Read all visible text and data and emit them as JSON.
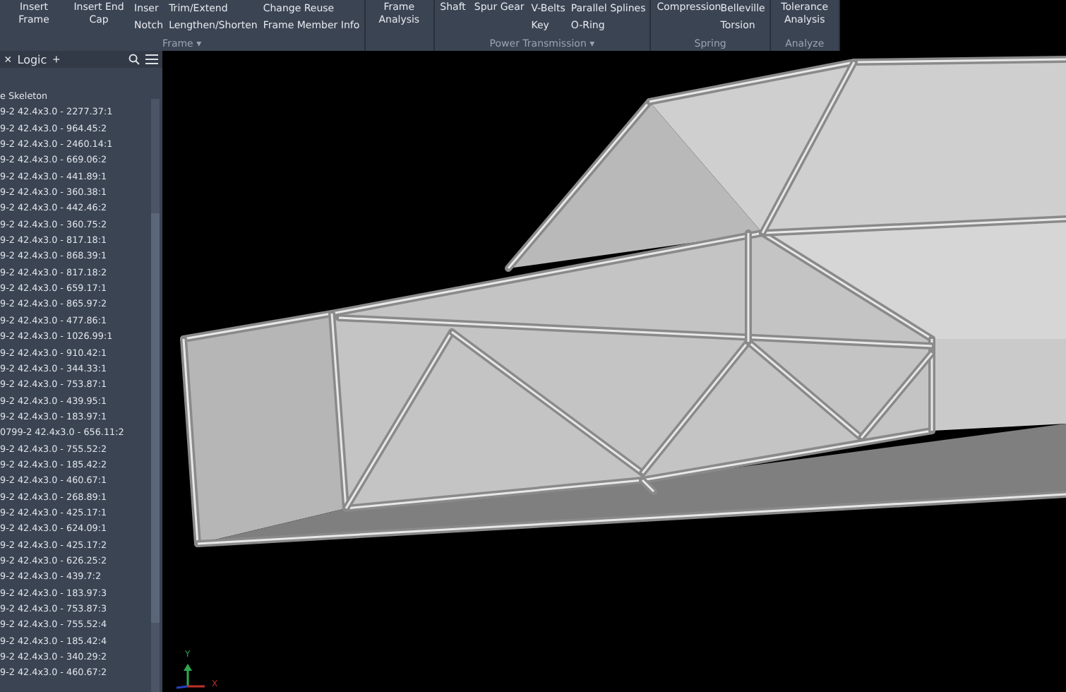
{
  "ribbon": {
    "groups": [
      {
        "label": "Frame ▾",
        "tools": [
          {
            "kind": "big",
            "label": "Insert Frame"
          },
          {
            "kind": "big",
            "label": "Insert End Cap"
          },
          {
            "kind": "stack",
            "items": [
              "Inser",
              "Notch"
            ]
          },
          {
            "kind": "stack",
            "items": [
              "Trim/Extend",
              "Lengthen/Shorten"
            ]
          },
          {
            "kind": "stack",
            "items": [
              "Change Reuse",
              "Frame Member Info"
            ]
          }
        ]
      },
      {
        "tools": [
          {
            "kind": "big",
            "label": "Frame Analysis"
          }
        ]
      },
      {
        "label": "Power Transmission ▾",
        "tools": [
          {
            "kind": "big",
            "label": "Shaft"
          },
          {
            "kind": "big",
            "label": "Spur Gear"
          },
          {
            "kind": "stack",
            "items": [
              "V-Belts",
              "Key"
            ]
          },
          {
            "kind": "stack",
            "items": [
              "Parallel Splines",
              "O-Ring"
            ]
          }
        ]
      },
      {
        "label": "Spring",
        "tools": [
          {
            "kind": "big",
            "label": "Compression"
          },
          {
            "kind": "stack",
            "items": [
              "Belleville",
              "Torsion"
            ]
          }
        ]
      },
      {
        "label": "Analyze",
        "tools": [
          {
            "kind": "big",
            "label": "Tolerance Analysis"
          }
        ]
      }
    ]
  },
  "browser": {
    "close": "×",
    "tab": "Logic",
    "add": "+",
    "tree": [
      {
        "label": "e Skeleton",
        "children": [
          {
            "label": "9-2 42.4x3.0 - 2277.37:1"
          },
          {
            "label": "9-2 42.4x3.0 - 964.45:2"
          },
          {
            "label": "9-2 42.4x3.0 - 2460.14:1"
          },
          {
            "label": "9-2 42.4x3.0 - 669.06:2"
          },
          {
            "label": "9-2 42.4x3.0 - 441.89:1"
          },
          {
            "label": "9-2 42.4x3.0 - 360.38:1"
          },
          {
            "label": "9-2 42.4x3.0 - 442.46:2"
          },
          {
            "label": "9-2 42.4x3.0 - 360.75:2"
          },
          {
            "label": "9-2 42.4x3.0 - 817.18:1"
          },
          {
            "label": "9-2 42.4x3.0 - 868.39:1"
          },
          {
            "label": "9-2 42.4x3.0 - 817.18:2"
          },
          {
            "label": "9-2 42.4x3.0 - 659.17:1"
          },
          {
            "label": "9-2 42.4x3.0 - 865.97:2"
          },
          {
            "label": "9-2 42.4x3.0 - 477.86:1"
          },
          {
            "label": "9-2 42.4x3.0 - 1026.99:1"
          },
          {
            "label": "9-2 42.4x3.0 - 910.42:1"
          },
          {
            "label": "9-2 42.4x3.0 - 344.33:1"
          },
          {
            "label": "9-2 42.4x3.0 - 753.87:1"
          },
          {
            "label": "9-2 42.4x3.0 - 439.95:1"
          },
          {
            "label": "9-2 42.4x3.0 - 183.97:1"
          },
          {
            "label": "0799-2 42.4x3.0 - 656.11:2"
          },
          {
            "label": "9-2 42.4x3.0 - 755.52:2"
          },
          {
            "label": "9-2 42.4x3.0 - 185.42:2"
          },
          {
            "label": "9-2 42.4x3.0 - 460.67:1"
          },
          {
            "label": "9-2 42.4x3.0 - 268.89:1"
          },
          {
            "label": "9-2 42.4x3.0 - 425.17:1"
          },
          {
            "label": "9-2 42.4x3.0 - 624.09:1"
          },
          {
            "label": "9-2 42.4x3.0 - 425.17:2"
          },
          {
            "label": "9-2 42.4x3.0 - 626.25:2"
          },
          {
            "label": "9-2 42.4x3.0 - 439.7:2"
          },
          {
            "label": "9-2 42.4x3.0 - 183.97:3"
          },
          {
            "label": "9-2 42.4x3.0 - 753.87:3"
          },
          {
            "label": "9-2 42.4x3.0 - 755.52:4"
          },
          {
            "label": "9-2 42.4x3.0 - 185.42:4"
          },
          {
            "label": "9-2 42.4x3.0 - 340.29:2"
          },
          {
            "label": "9-2 42.4x3.0 - 460.67:2"
          }
        ]
      }
    ]
  },
  "viewport": {
    "axis": {
      "y": "Y",
      "x": "X"
    }
  }
}
